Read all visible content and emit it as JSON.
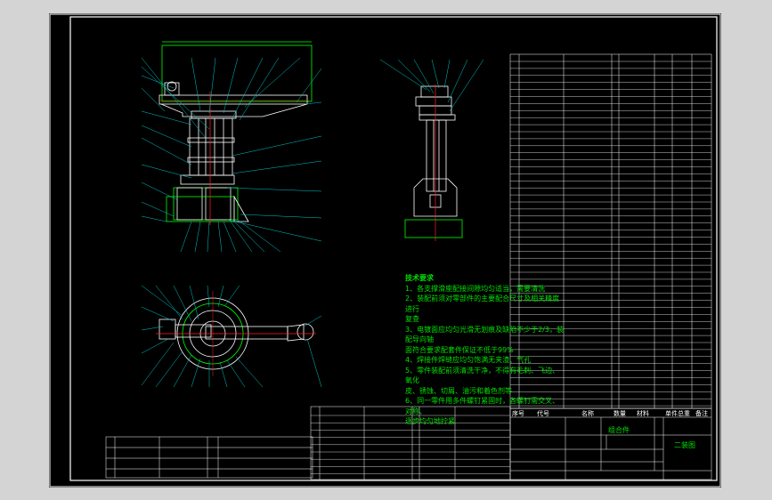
{
  "tech_notes": {
    "title": "技术要求",
    "lines": [
      "1、各支撑滑座配接间隙均匀适当，需要清洗",
      "2、装配前须对零部件的主要配合尺寸及相关精度进行",
      "复查",
      "3、电镀面应均匀光滑无划痕及缺陷不少于2/3，装配导向轴",
      "面符合要求配套件保证不低于99%",
      "4、焊接件焊缝应均匀饱满无夹渣、气孔",
      "5、零件装配前须清洗干净，不得有毛刺、飞边、氧化",
      "皮、锈蚀、切屑、油污和着色剂等",
      "6、同一零件用多件螺钉紧固时，各螺钉需交叉、对称、",
      "逐步均匀地拧紧"
    ]
  },
  "title_block": {
    "assembly_name": "组合件",
    "drawing_no": "二装图",
    "headers": [
      "序号",
      "代号",
      "名称",
      "数量",
      "材料",
      "单件总重",
      "备注"
    ]
  },
  "colors": {
    "background": "#000000",
    "outline": "#ffffff",
    "geometry": "#00ff00",
    "centerline": "#ff2020",
    "text": "#00e000",
    "dimension": "#00c8c8"
  }
}
